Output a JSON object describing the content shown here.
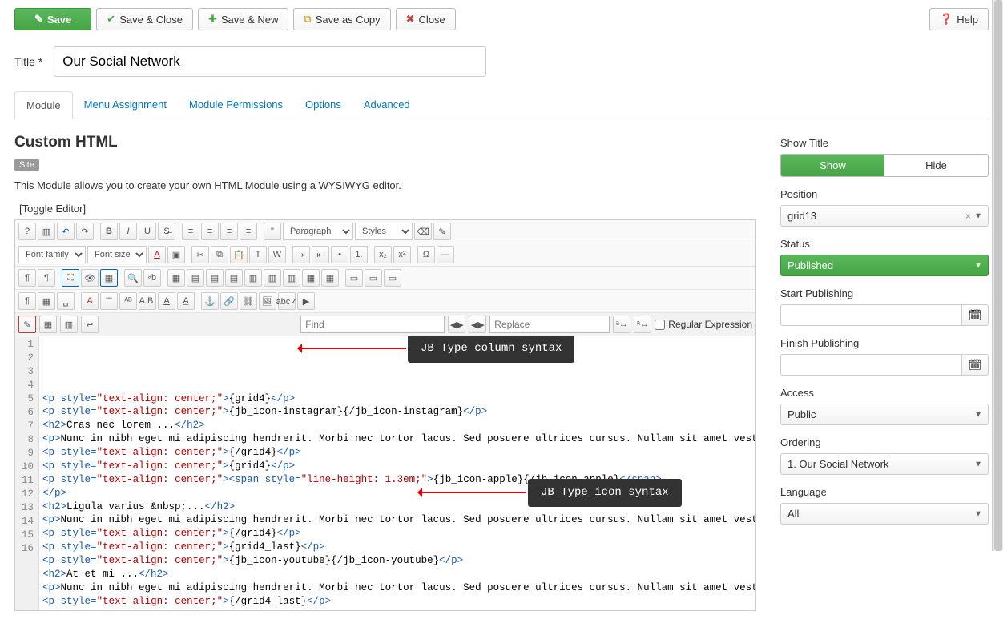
{
  "toolbar": {
    "save": "Save",
    "save_close": "Save & Close",
    "save_new": "Save & New",
    "save_copy": "Save as Copy",
    "close": "Close",
    "help": "Help"
  },
  "title_label": "Title *",
  "title_value": "Our Social Network",
  "tabs": [
    "Module",
    "Menu Assignment",
    "Module Permissions",
    "Options",
    "Advanced"
  ],
  "module": {
    "heading": "Custom HTML",
    "site_badge": "Site",
    "description": "This Module allows you to create your own HTML Module using a WYSIWYG editor.",
    "toggle_editor": "[Toggle Editor]"
  },
  "editor": {
    "paragraph": "Paragraph",
    "styles": "Styles",
    "font_family": "Font family",
    "font_size": "Font size",
    "find_placeholder": "Find",
    "replace_placeholder": "Replace",
    "regex_label": "Regular Expression"
  },
  "code_lines": [
    {
      "n": 1,
      "html": "<span class='tag'>&lt;p</span> <span class='attr'>style=</span><span class='str'>\"text-align: center;\"</span><span class='tag'>&gt;</span><span class='txt'>{grid4}</span><span class='tag'>&lt;/p&gt;</span>"
    },
    {
      "n": 2,
      "html": "<span class='tag'>&lt;p</span> <span class='attr'>style=</span><span class='str'>\"text-align: center;\"</span><span class='tag'>&gt;</span><span class='txt'>{jb_icon-instagram}{/jb_icon-instagram}</span><span class='tag'>&lt;/p&gt;</span>"
    },
    {
      "n": 3,
      "html": "<span class='tag'>&lt;h2&gt;</span><span class='txt'>Cras nec lorem ...</span><span class='tag'>&lt;/h2&gt;</span>"
    },
    {
      "n": 4,
      "html": "<span class='tag'>&lt;p&gt;</span><span class='txt'>Nunc in nibh eget mi adipiscing hendrerit. Morbi nec tortor lacus. Sed posuere ultrices cursus. Nullam sit amet vestibulum mauris, id blandit libero.</span><span class='tag'>&lt;/p&gt;</span>"
    },
    {
      "n": 5,
      "html": "<span class='tag'>&lt;p</span> <span class='attr'>style=</span><span class='str'>\"text-align: center;\"</span><span class='tag'>&gt;</span><span class='txt'>{/grid4}</span><span class='tag'>&lt;/p&gt;</span>"
    },
    {
      "n": 6,
      "html": "<span class='tag'>&lt;p</span> <span class='attr'>style=</span><span class='str'>\"text-align: center;\"</span><span class='tag'>&gt;</span><span class='txt'>{grid4}</span><span class='tag'>&lt;/p&gt;</span>"
    },
    {
      "n": 7,
      "html": "<span class='tag'>&lt;p</span> <span class='attr'>style=</span><span class='str'>\"text-align: center;\"</span><span class='tag'>&gt;&lt;span</span> <span class='attr'>style=</span><span class='str'>\"line-height: 1.3em;\"</span><span class='tag'>&gt;</span><span class='txt'>{jb_icon-apple}{/jb_icon-apple}</span><span class='tag'>&lt;/span&gt;</span>"
    },
    {
      "n": 8,
      "html": "<span class='tag'>&lt;/p&gt;</span>"
    },
    {
      "n": 9,
      "html": "<span class='tag'>&lt;h2&gt;</span><span class='txt'>Ligula varius &amp;nbsp;...</span><span class='tag'>&lt;/h2&gt;</span>"
    },
    {
      "n": 10,
      "html": "<span class='tag'>&lt;p&gt;</span><span class='txt'>Nunc in nibh eget mi adipiscing hendrerit. Morbi nec tortor lacus. Sed posuere ultrices cursus. Nullam sit amet vestibulum mauris, id blandit libero.</span><span class='tag'>&lt;/p&gt;</span>"
    },
    {
      "n": 11,
      "html": "<span class='tag'>&lt;p</span> <span class='attr'>style=</span><span class='str'>\"text-align: center;\"</span><span class='tag'>&gt;</span><span class='txt'>{/grid4}</span><span class='tag'>&lt;/p&gt;</span>"
    },
    {
      "n": 12,
      "html": "<span class='tag'>&lt;p</span> <span class='attr'>style=</span><span class='str'>\"text-align: center;\"</span><span class='tag'>&gt;</span><span class='txt'>{grid4_last}</span><span class='tag'>&lt;/p&gt;</span>"
    },
    {
      "n": 13,
      "html": "<span class='tag'>&lt;p</span> <span class='attr'>style=</span><span class='str'>\"text-align: center;\"</span><span class='tag'>&gt;</span><span class='txt'>{jb_icon-youtube}{/jb_icon-youtube}</span><span class='tag'>&lt;/p&gt;</span>"
    },
    {
      "n": 14,
      "html": "<span class='tag'>&lt;h2&gt;</span><span class='txt'>At et mi ...</span><span class='tag'>&lt;/h2&gt;</span>"
    },
    {
      "n": 15,
      "html": "<span class='tag'>&lt;p&gt;</span><span class='txt'>Nunc in nibh eget mi adipiscing hendrerit. Morbi nec tortor lacus. Sed posuere ultrices cursus. Nullam sit amet vestibulum mauris, id blandit libero.</span><span class='tag'>&lt;/p&gt;</span>"
    },
    {
      "n": 16,
      "html": "<span class='tag'>&lt;p</span> <span class='attr'>style=</span><span class='str'>\"text-align: center;\"</span><span class='tag'>&gt;</span><span class='txt'>{/grid4_last}</span><span class='tag'>&lt;/p&gt;</span>"
    }
  ],
  "annotations": {
    "col": "JB Type column syntax",
    "icon": "JB Type icon syntax"
  },
  "sidebar": {
    "show_title_label": "Show Title",
    "show": "Show",
    "hide": "Hide",
    "position_label": "Position",
    "position_value": "grid13",
    "status_label": "Status",
    "status_value": "Published",
    "start_pub_label": "Start Publishing",
    "finish_pub_label": "Finish Publishing",
    "access_label": "Access",
    "access_value": "Public",
    "ordering_label": "Ordering",
    "ordering_value": "1. Our Social Network",
    "language_label": "Language",
    "language_value": "All"
  }
}
